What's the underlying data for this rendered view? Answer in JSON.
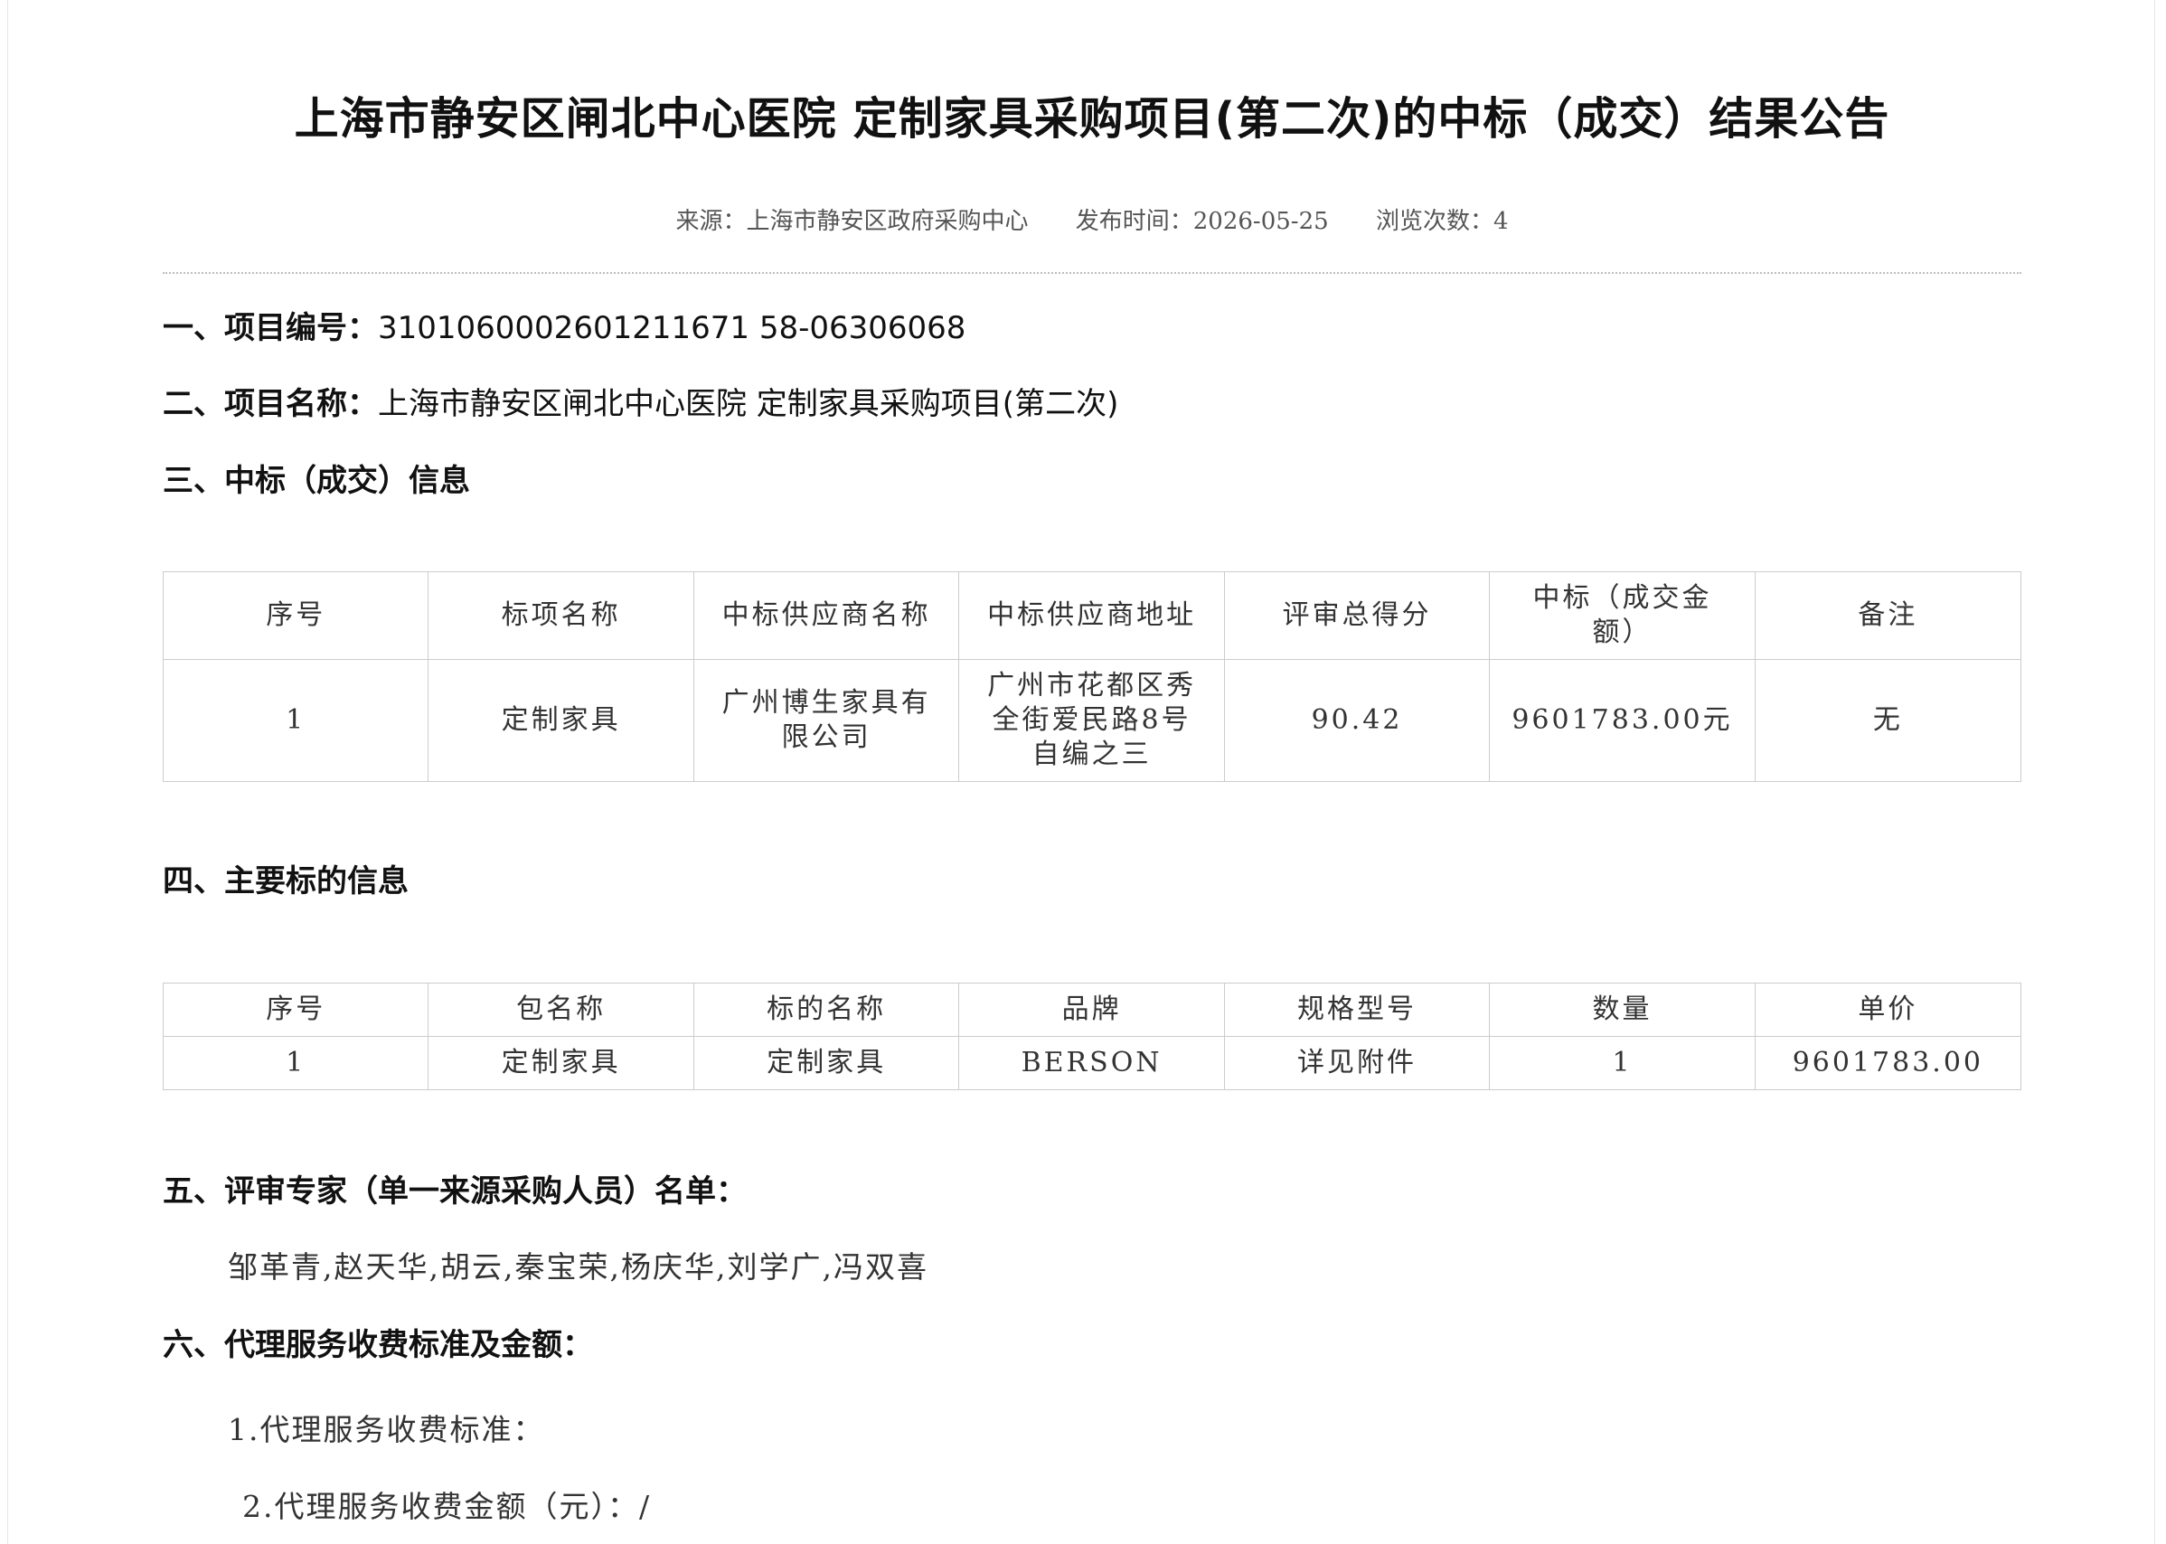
{
  "header": {
    "title": "上海市静安区闸北中心医院 定制家具采购项目(第二次)的中标（成交）结果公告",
    "source": "来源：上海市静安区政府采购中心",
    "publish_time": "发布时间：2026-05-25",
    "views": "浏览次数：4"
  },
  "sections": {
    "s1_label": "一、项目编号：",
    "s1_value": "3101060002601211671 58-06306068",
    "s2_label": "二、项目名称：",
    "s2_value": "上海市静安区闸北中心医院 定制家具采购项目(第二次)",
    "s3_label": "三、中标（成交）信息",
    "s4_label": "四、主要标的信息",
    "s5_label": "五、评审专家（单一来源采购人员）名单：",
    "s5_value": "邹革青,赵天华,胡云,秦宝荣,杨庆华,刘学广,冯双喜",
    "s6_label": "六、代理服务收费标准及金额：",
    "s6_item1": "1.代理服务收费标准：",
    "s6_item2": "2.代理服务收费金额（元）：/"
  },
  "award_table": {
    "headers": [
      "序号",
      "标项名称",
      "中标供应商名称",
      "中标供应商地址",
      "评审总得分",
      "中标（成交金额）",
      "备注"
    ],
    "rows": [
      [
        "1",
        "定制家具",
        "广州博生家具有限公司",
        "广州市花都区秀全街爱民路8号自编之三",
        "90.42",
        "9601783.00元",
        "无"
      ]
    ]
  },
  "item_table": {
    "headers": [
      "序号",
      "包名称",
      "标的名称",
      "品牌",
      "规格型号",
      "数量",
      "单价"
    ],
    "rows": [
      [
        "1",
        "定制家具",
        "定制家具",
        "BERSON",
        "详见附件",
        "1",
        "9601783.00"
      ]
    ]
  }
}
